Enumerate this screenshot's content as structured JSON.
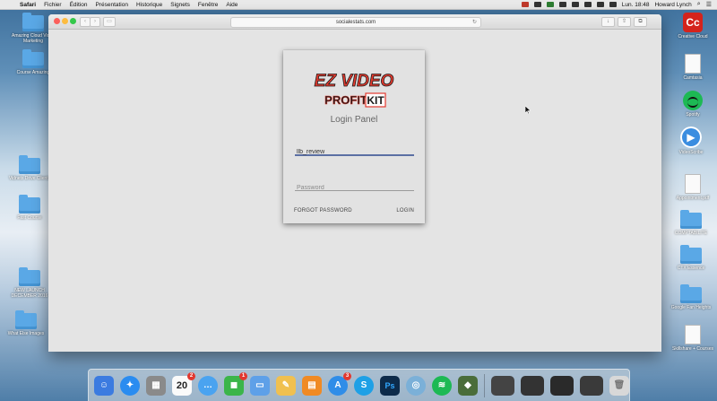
{
  "menubar": {
    "apple_glyph": "",
    "app_name": "Safari",
    "items": [
      "Fichier",
      "Édition",
      "Présentation",
      "Historique",
      "Signets",
      "Fenêtre",
      "Aide"
    ],
    "clock": "Lun. 18:48",
    "user": "Howard Lynch",
    "search_glyph": "⌕",
    "menu_glyph": "☰"
  },
  "desktop": {
    "left_items": [
      {
        "label": "Amazing Cloud Video Marketing"
      },
      {
        "label": "Course Amazing"
      },
      {
        "label": "Vidnets Drive Clients"
      },
      {
        "label": "Fast Course"
      },
      {
        "label": "NEW LAUNCH DECEMBER 2016"
      },
      {
        "label": "What Else Images"
      }
    ],
    "right_items": [
      {
        "label": "Creative Cloud"
      },
      {
        "label": "Camtasia"
      },
      {
        "label": "Spotify"
      },
      {
        "label": "VideoScribe"
      },
      {
        "label": "Appointment.pdf"
      },
      {
        "label": "COMPTABILITE"
      },
      {
        "label": "CTX Essence"
      },
      {
        "label": "Google Fan Heights"
      },
      {
        "label": "Skillshare + Courses"
      }
    ]
  },
  "browser": {
    "url": "socialestats.com",
    "reload_glyph": "↻",
    "back_glyph": "‹",
    "forward_glyph": "›",
    "sidebar_glyph": "▭",
    "download_glyph": "↓",
    "share_glyph": "⇧",
    "tabs_glyph": "⧉"
  },
  "login": {
    "logo_line1": "EZ VIDEO",
    "logo_line2a": "PROFIT",
    "logo_line2b": "KIT",
    "title": "Login Panel",
    "username_value": "llb_review",
    "password_placeholder": "Password",
    "forgot_label": "FORGOT PASSWORD",
    "login_label": "LOGIN"
  },
  "dock": {
    "calendar_day": "20",
    "calendar_badge": "2",
    "facetime_badge": "1",
    "appstore_badge": "3"
  },
  "colors": {
    "accent_underline": "#5b6fa3",
    "logo_red": "#e23a2e"
  }
}
